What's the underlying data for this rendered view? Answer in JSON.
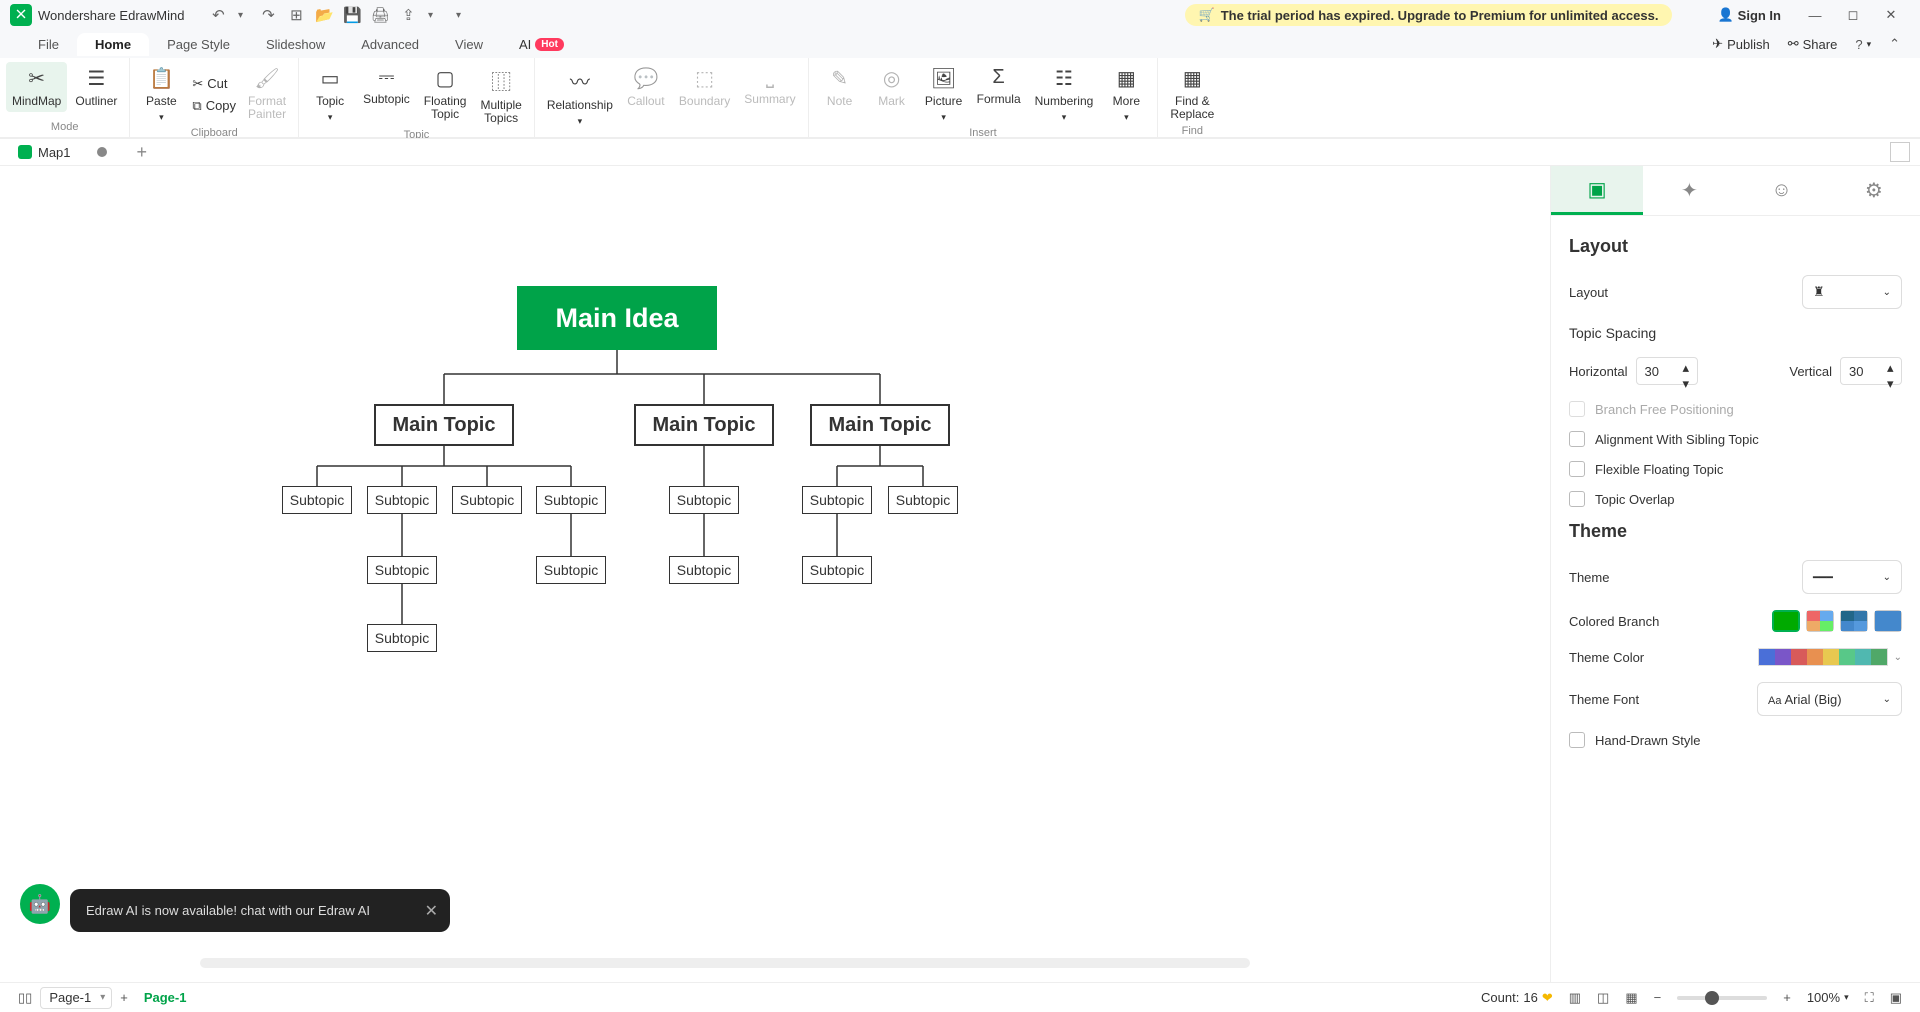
{
  "app": {
    "title": "Wondershare EdrawMind"
  },
  "titlebar": {
    "trial": "The trial period has expired. Upgrade to Premium for unlimited access.",
    "signin": "Sign In"
  },
  "menu": {
    "tabs": [
      "File",
      "Home",
      "Page Style",
      "Slideshow",
      "Advanced",
      "View",
      "AI"
    ],
    "active": "Home",
    "hot_badge": "Hot",
    "publish": "Publish",
    "share": "Share"
  },
  "ribbon": {
    "mode": {
      "mindmap": "MindMap",
      "outliner": "Outliner",
      "group": "Mode"
    },
    "clipboard": {
      "paste": "Paste",
      "cut": "Cut",
      "copy": "Copy",
      "format_painter": "Format\nPainter",
      "group": "Clipboard"
    },
    "topic": {
      "topic": "Topic",
      "subtopic": "Subtopic",
      "floating": "Floating\nTopic",
      "multiple": "Multiple\nTopics",
      "group": "Topic"
    },
    "annotate": {
      "relationship": "Relationship",
      "callout": "Callout",
      "boundary": "Boundary",
      "summary": "Summary"
    },
    "insert": {
      "note": "Note",
      "mark": "Mark",
      "picture": "Picture",
      "formula": "Formula",
      "numbering": "Numbering",
      "more": "More",
      "group": "Insert"
    },
    "find": {
      "find_replace": "Find &\nReplace",
      "group": "Find"
    }
  },
  "doc_tabs": {
    "name": "Map1"
  },
  "canvas": {
    "main_idea": "Main Idea",
    "topics": [
      "Main Topic",
      "Main Topic",
      "Main Topic"
    ],
    "subtopic": "Subtopic"
  },
  "ai_tooltip": "Edraw AI is now available!  chat with our Edraw AI",
  "side": {
    "layout_h": "Layout",
    "layout_lbl": "Layout",
    "spacing_h": "Topic Spacing",
    "horizontal": "Horizontal",
    "h_val": "30",
    "vertical": "Vertical",
    "v_val": "30",
    "branch_free": "Branch Free Positioning",
    "align_sibling": "Alignment With Sibling Topic",
    "flex_float": "Flexible Floating Topic",
    "overlap": "Topic Overlap",
    "theme_h": "Theme",
    "theme_lbl": "Theme",
    "colored_branch": "Colored Branch",
    "theme_color": "Theme Color",
    "theme_font": "Theme Font",
    "theme_font_val": "Arial (Big)",
    "hand_drawn": "Hand-Drawn Style"
  },
  "status": {
    "page_sel": "Page-1",
    "page_active": "Page-1",
    "count_label": "Count:",
    "count_val": "16",
    "zoom": "100%"
  }
}
